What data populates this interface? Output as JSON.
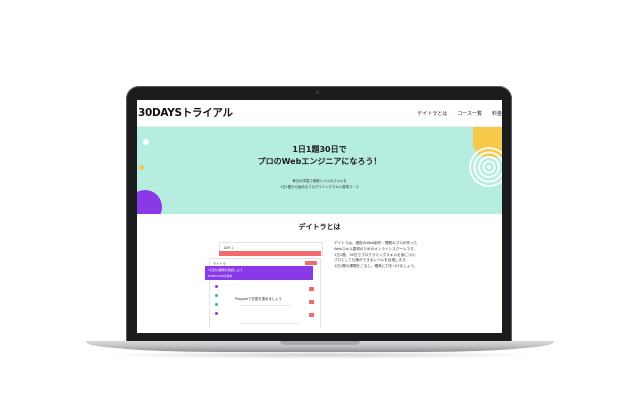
{
  "site": {
    "logo": "30DAYSトライアル",
    "nav": [
      "デイトラとは",
      "コース一覧",
      "料金"
    ]
  },
  "hero": {
    "title_line1": "1日1題30日で",
    "title_line2": "プロのWebエンジニアになろう！",
    "sub_line1": "毎日の学習で実務レベルのスキルを",
    "sub_line2": "1日1題から始めるプログラミングスキル習得コース"
  },
  "about": {
    "title": "デイトラとは",
    "body_lines": [
      "デイトラは、現役のWeb制作・開発のプロが作った",
      "Webスキル習得のためのオンラインスクールです。",
      "1日1題、30日でプログラミングスキルを身につけ、",
      "プロとして仕事ができるレベルを目指します。",
      "1日1題の課題をこなし、確実に力をつけましょう。"
    ],
    "mock": {
      "window_title": "DAY 1",
      "page_head": "デイトラ",
      "purple_lines": [
        "1日目の課題を確認しよう",
        "HTML/CSSの基本"
      ],
      "task_label": "Progateで学習を進めましょう"
    }
  },
  "colors": {
    "hero_bg": "#b5ede0",
    "accent_purple": "#8a39e8",
    "accent_yellow": "#f7c94a",
    "accent_red": "#f06b6b"
  }
}
